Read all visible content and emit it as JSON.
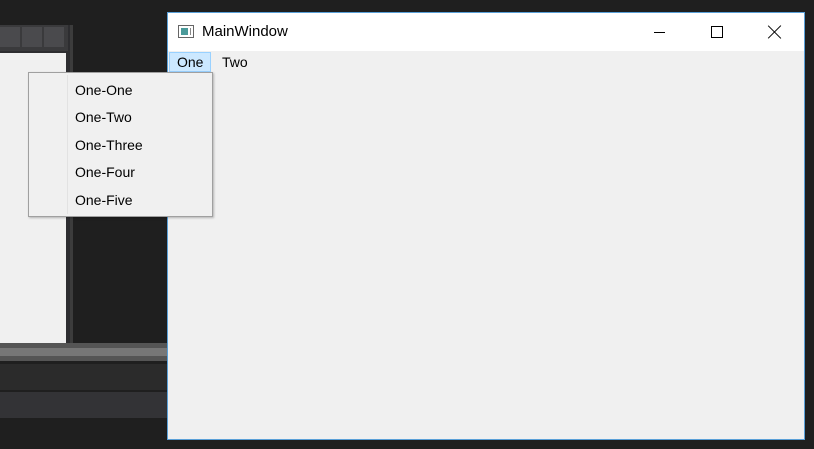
{
  "window": {
    "title": "MainWindow",
    "icon": "window-app-icon",
    "controls": [
      "minimize-icon",
      "maximize-icon",
      "close-icon"
    ]
  },
  "menu": {
    "items": [
      {
        "label": "One",
        "open": true
      },
      {
        "label": "Two",
        "open": false
      }
    ]
  },
  "dropdown": {
    "parent": "One",
    "items": [
      {
        "label": "One-One"
      },
      {
        "label": "One-Two"
      },
      {
        "label": "One-Three"
      },
      {
        "label": "One-Four"
      },
      {
        "label": "One-Five"
      }
    ]
  },
  "colors": {
    "menu_highlight": "#cce8ff",
    "menu_highlight_border": "#99d1ff",
    "window_border": "#5aa0d8",
    "desktop_background": "#1f1f1f"
  }
}
